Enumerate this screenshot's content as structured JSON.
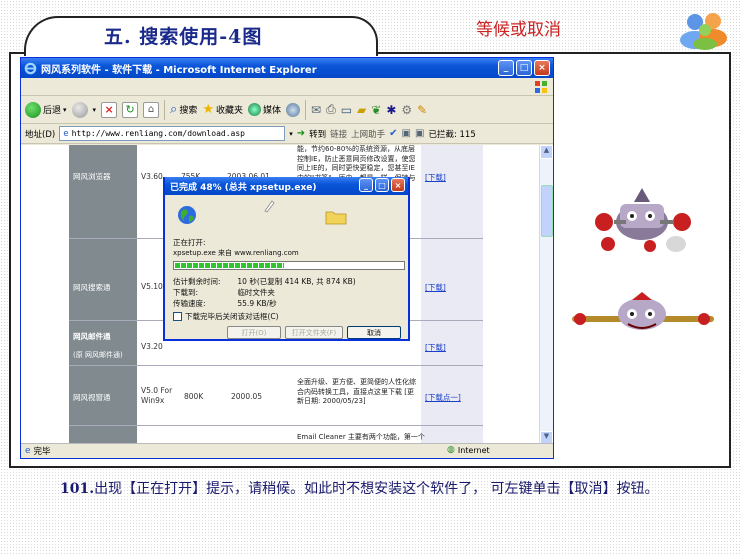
{
  "slide": {
    "title": "五. 搜索使用-4图",
    "corner_note": "等候或取消",
    "caption_number": "101.",
    "caption_text": "出现【正在打开】提示，请稍候。如此时不想安装这个软件了， 可左键单击【取消】按钮。"
  },
  "browser": {
    "window_title": "网风系列软件 - 软件下载 - Microsoft Internet Explorer",
    "toolbar": {
      "back_label": "后退",
      "search_label": "搜索",
      "favorites_label": "收藏夹",
      "media_label": "媒体"
    },
    "address": {
      "label": "地址(D)",
      "url": "http://www.renliang.com/download.asp",
      "go_label": "转到",
      "links_label": "链接",
      "upload_label": "上网助手",
      "blocked_label": "已拦截: 115"
    },
    "table": {
      "rows": [
        {
          "name": "网风浏览器",
          "version": "V3.60",
          "size": "755K",
          "date": "2003.06.01",
          "desc": "能，节约60-80%的系统资源，从底层控制IE，防止恶意网页修改设置，使您同上IE的，同时更快更稳定，您甚至IE中的\"书签\"、历史，都是一样，保持与IE完全兼容。",
          "link": "[下载]"
        },
        {
          "name": "网风搜索通",
          "version": "V5.10",
          "link": "[下载]"
        },
        {
          "name": "网风邮件通",
          "sub": "(原 网风邮件通)",
          "version": "V3.20",
          "link": "[下载]"
        },
        {
          "name": "网风视窗通",
          "version": "V5.0 For Win9x",
          "size": "800K",
          "date": "2000.05",
          "desc": "全面升级、更方便、更简便的人性化综合内码转换工具，直接点这里下载 [更新日期: 2000/05/23]",
          "link": "[下载点一]"
        },
        {
          "desc": "Email Cleaner 主要有两个功能，第一个"
        }
      ]
    },
    "status": {
      "left": "完毕",
      "zone": "Internet"
    }
  },
  "download_dialog": {
    "title": "已完成 48% (总共 xpsetup.exe)",
    "opening_label": "正在打开:",
    "file_from": "xpsetup.exe 来自 www.renliang.com",
    "progress_percent": 48,
    "est_time_label": "估计剩余时间:",
    "est_time_value": "10 秒(已复制 414 KB, 共 874 KB)",
    "download_to_label": "下载到:",
    "download_to_value": "临时文件夹",
    "speed_label": "传输速度:",
    "speed_value": "55.9 KB/秒",
    "close_checkbox_label": "下载完毕后关闭该对话框(C)",
    "open_button": "打开(O)",
    "open_folder_button": "打开文件夹(F)",
    "cancel_button": "取消"
  }
}
